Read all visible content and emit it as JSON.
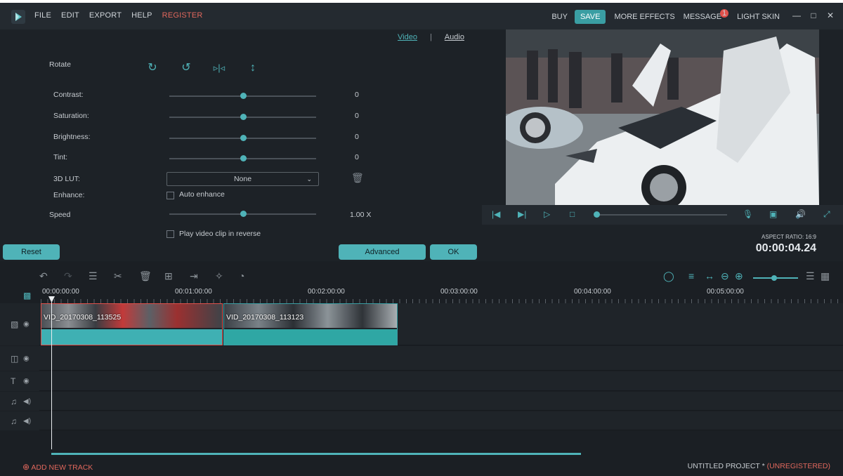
{
  "menu": {
    "items": [
      "FILE",
      "EDIT",
      "EXPORT",
      "HELP",
      "REGISTER"
    ],
    "right": {
      "buy": "BUY",
      "save": "SAVE",
      "more_effects": "MORE EFFECTS",
      "message": "MESSAGE",
      "message_badge": "1",
      "light_skin": "LIGHT SKIN"
    }
  },
  "edit": {
    "tabs": {
      "video": "Video",
      "sep": "|",
      "audio": "Audio"
    },
    "rotate_label": "Rotate",
    "sliders": [
      {
        "label": "Contrast:",
        "value": "0",
        "level": 0.5
      },
      {
        "label": "Saturation:",
        "value": "0",
        "level": 0.5
      },
      {
        "label": "Brightness:",
        "value": "0",
        "level": 0.5
      },
      {
        "label": "Tint:",
        "value": "0",
        "level": 0.5
      }
    ],
    "lut_label": "3D LUT:",
    "lut_value": "None",
    "enhance_label": "Enhance:",
    "auto_enhance": "Auto enhance",
    "speed_label": "Speed",
    "speed_value": "1.00 X",
    "speed_level": 0.5,
    "reverse_label": "Play video clip in reverse",
    "reset": "Reset",
    "advanced": "Advanced",
    "ok": "OK"
  },
  "preview": {
    "aspect": "ASPECT RATIO: 16:9",
    "time": "00:00:04.24",
    "progress": 0.0
  },
  "timeline": {
    "ticks": [
      "00:00:00:00",
      "00:01:00:00",
      "00:02:00:00",
      "00:03:00:00",
      "00:04:00:00",
      "00:05:00:00"
    ],
    "clips": [
      {
        "name": "VID_20170308_113525"
      },
      {
        "name": "VID_20170308_113123"
      }
    ]
  },
  "footer": {
    "add_track": "ADD NEW TRACK",
    "project": "UNTITLED PROJECT *",
    "unregistered": "(UNREGISTERED)"
  }
}
